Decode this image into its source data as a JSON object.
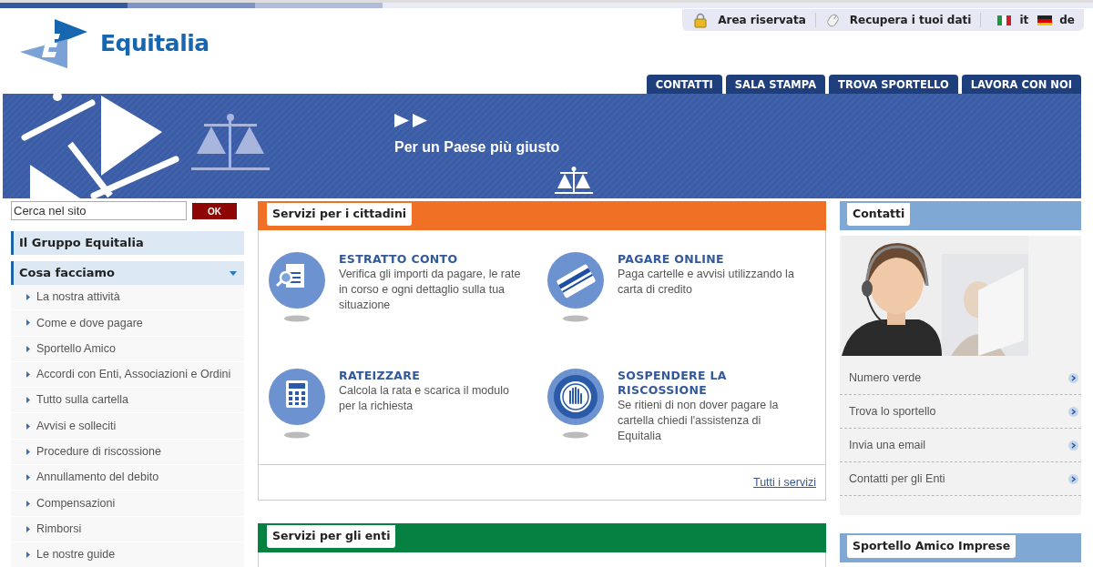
{
  "logo": {
    "name": "Equitalia"
  },
  "utility_links": [
    {
      "label": "Area riservata",
      "kind": "lock"
    },
    {
      "label": "Recupera i tuoi dati",
      "kind": "mouse"
    }
  ],
  "languages": [
    {
      "code": "it",
      "kind": "italy"
    },
    {
      "code": "de",
      "kind": "germany"
    }
  ],
  "nav_tabs": [
    "CONTATTI",
    "SALA STAMPA",
    "TROVA SPORTELLO",
    "LAVORA CON NOI"
  ],
  "banner": {
    "tagline": "Per un Paese più giusto"
  },
  "search": {
    "value": "Cerca nel sito",
    "button": "OK"
  },
  "sidebar": {
    "items": [
      {
        "label": "Il Gruppo Equitalia",
        "expanded": false
      },
      {
        "label": "Cosa facciamo",
        "expanded": true,
        "children": [
          {
            "label": "La nostra attività"
          },
          {
            "label": "Come e dove pagare"
          },
          {
            "label": "Sportello Amico"
          },
          {
            "label": "Accordi con Enti, Associazioni e Ordini"
          },
          {
            "label": "Tutto sulla cartella"
          },
          {
            "label": "Avvisi e solleciti"
          },
          {
            "label": "Procedure di riscossione"
          },
          {
            "label": "Annullamento del debito"
          },
          {
            "label": "Compensazioni"
          },
          {
            "label": "Rimborsi"
          },
          {
            "label": "Le nostre guide"
          }
        ]
      }
    ]
  },
  "panels": [
    {
      "title": "Servizi per i cittadini",
      "color": "#f07126",
      "services": [
        {
          "title": "ESTRATTO CONTO",
          "description": "Verifica gli importi da pagare, le rate in corso e ogni dettaglio sulla tua situazione",
          "kind": "document"
        },
        {
          "title": "PAGARE ONLINE",
          "description": "Paga cartelle e avvisi utilizzando la carta di credito",
          "kind": "card"
        },
        {
          "title": "RATEIZZARE",
          "description": "Calcola la rata e scarica il modulo per la richiesta",
          "kind": "calculator"
        },
        {
          "title": "SOSPENDERE LA RISCOSSIONE",
          "description": "Se ritieni di non dover pagare la cartella chiedi l'assistenza di Equitalia",
          "kind": "hand"
        }
      ],
      "link": "Tutti i servizi"
    },
    {
      "title": "Servizi per gli enti",
      "color": "#078141"
    }
  ],
  "contacts": {
    "title": "Contatti",
    "links": [
      "Numero verde",
      "Trova lo sportello",
      "Invia una email",
      "Contatti per gli Enti"
    ]
  },
  "side_boxes": [
    {
      "title": "Sportello Amico Imprese"
    }
  ]
}
